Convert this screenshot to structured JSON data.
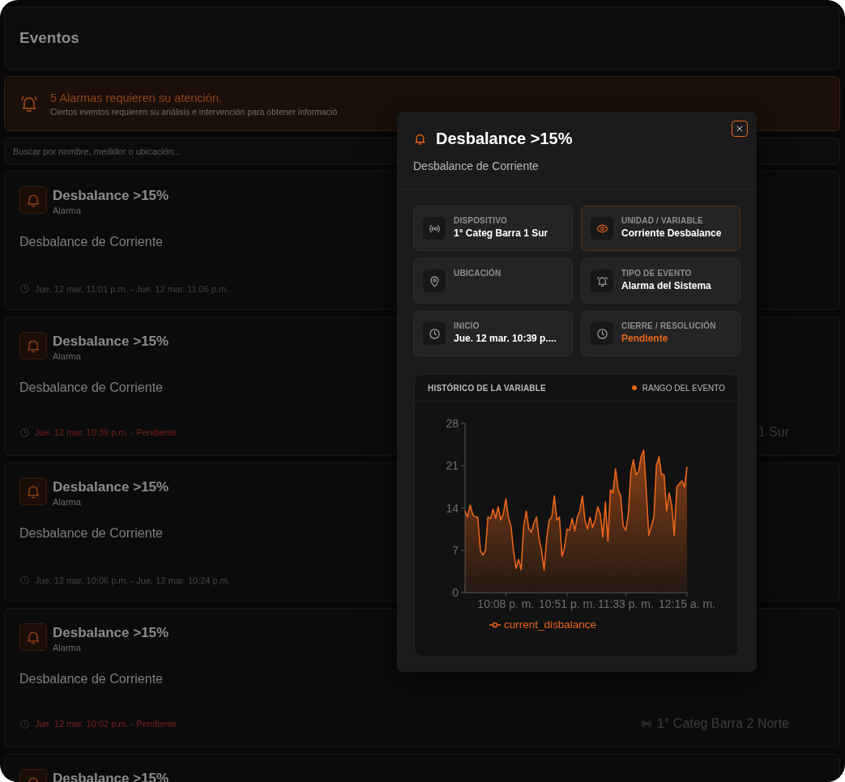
{
  "page": {
    "title": "Eventos"
  },
  "alert": {
    "title": "5 Alarmas requieren su atención.",
    "message": "Ciertos eventos requieren su análisis e intervención para obtener informació"
  },
  "search": {
    "placeholder": "Buscar por nombre, medidor o ubicación..."
  },
  "events": [
    {
      "title": "Desbalance >15%",
      "type": "Alarma",
      "description": "Desbalance de Corriente",
      "time": "Jue. 12 mar. 11:01 p.m. - Jue. 12 mar. 11:06 p.m.",
      "pending": false
    },
    {
      "title": "Desbalance >15%",
      "type": "Alarma",
      "description": "Desbalance de Corriente",
      "time": "Jue. 12 mar. 10:39 p.m. - Pendiente",
      "pending": true,
      "device": "1 Sur"
    },
    {
      "title": "Desbalance >15%",
      "type": "Alarma",
      "description": "Desbalance de Corriente",
      "time": "Jue. 12 mar. 10:06 p.m. - Jue. 12 mar. 10:24 p.m.",
      "pending": false
    },
    {
      "title": "Desbalance >15%",
      "type": "Alarma",
      "description": "Desbalance de Corriente",
      "time": "Jue. 12 mar. 10:02 p.m. - Pendiente",
      "pending": true,
      "device": "1° Categ Barra 2 Norte"
    },
    {
      "title": "Desbalance >15%"
    }
  ],
  "modal": {
    "title": "Desbalance >15%",
    "subtitle": "Desbalance de Corriente",
    "details": [
      {
        "kind": "device",
        "label": "DISPOSITIVO",
        "value": "1° Categ Barra 1 Sur",
        "highlighted": false,
        "accent": false
      },
      {
        "kind": "variable",
        "label": "UNIDAD / VARIABLE",
        "value": "Corriente Desbalance",
        "highlighted": true,
        "accent": false
      },
      {
        "kind": "location",
        "label": "UBICACIÓN",
        "highlighted": false
      },
      {
        "kind": "event_type",
        "label": "TIPO DE EVENTO",
        "value": "Alarma del Sistema",
        "highlighted": false,
        "accent": false
      },
      {
        "kind": "time",
        "label": "INICIO",
        "value": "Jue. 12 mar. 10:39 p....",
        "highlighted": false,
        "accent": false
      },
      {
        "kind": "time",
        "label": "CIERRE / RESOLUCIÓN",
        "value": "Pendiente",
        "highlighted": false,
        "accent": true
      }
    ],
    "history": {
      "title": "HISTÓRICO DE LA VARIABLE",
      "legend": "RANGO DEL EVENTO",
      "chart_data": {
        "type": "area",
        "categories": [
          null,
          null,
          null,
          null,
          null,
          null,
          null,
          null,
          null,
          null,
          null,
          null,
          null,
          null,
          null,
          null,
          "10:08 p. m.",
          null,
          null,
          null,
          null,
          null,
          null,
          null,
          null,
          null,
          null,
          null,
          null,
          null,
          null,
          null,
          null,
          null,
          null,
          null,
          null,
          null,
          null,
          null,
          "10:51 p. m.",
          null,
          null,
          null,
          null,
          null,
          null,
          null,
          null,
          null,
          null,
          null,
          null,
          null,
          null,
          null,
          null,
          null,
          null,
          null,
          null,
          null,
          null,
          "11:33 p. m.",
          null,
          null,
          null,
          null,
          null,
          null,
          null,
          null,
          null,
          null,
          null,
          null,
          null,
          null,
          null,
          null,
          null,
          null,
          null,
          null,
          null,
          null,
          null,
          "12:15 a. m."
        ],
        "ylim": [
          0,
          28
        ],
        "yticks": [
          0,
          7,
          14,
          21,
          28
        ],
        "series": [
          {
            "name": "current_disbalance",
            "color": "#e8651a",
            "values": [
              13.5,
              12.5,
              14.5,
              13,
              12.5,
              12.5,
              7,
              6.2,
              7,
              12.5,
              12.2,
              13.8,
              12.3,
              14.2,
              12,
              13,
              15.5,
              12.5,
              11,
              7,
              4,
              5.5,
              3.8,
              11,
              13.5,
              10.5,
              10,
              11.5,
              12.5,
              9,
              7,
              3.7,
              9,
              12,
              12.5,
              16,
              12,
              12.5,
              6,
              7.5,
              10.5,
              10.3,
              12.3,
              10.2,
              12.5,
              13.5,
              16,
              12,
              10.5,
              12.5,
              10.8,
              12,
              14.2,
              13,
              9.2,
              15,
              8.5,
              17,
              16.5,
              20.5,
              17,
              16,
              11,
              10.3,
              13,
              20,
              22,
              19.5,
              20,
              22.5,
              23.6,
              17,
              9.5,
              11,
              12.5,
              21,
              22.5,
              19.5,
              19.5,
              13.5,
              16.5,
              14.5,
              9.5,
              17.5,
              18,
              18.5,
              17.5,
              20.8
            ]
          }
        ]
      }
    }
  }
}
